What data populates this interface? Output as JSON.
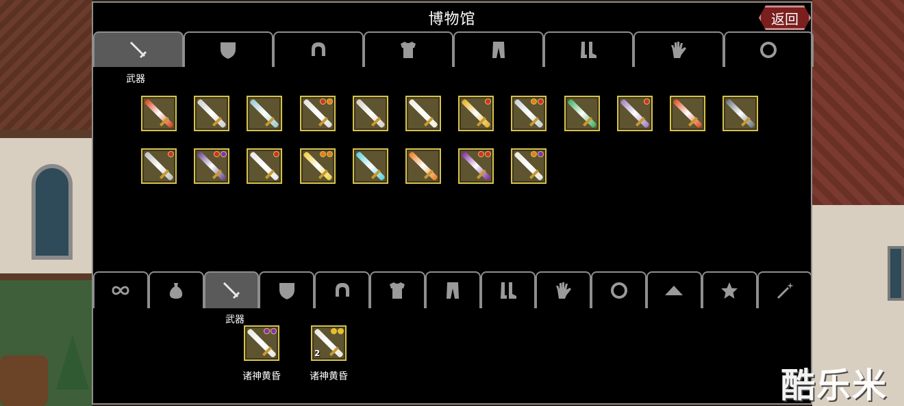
{
  "title": "博物馆",
  "return_label": "返回",
  "top_tabs": [
    {
      "icon": "sword-icon",
      "label": "武器",
      "active": true
    },
    {
      "icon": "shield-icon",
      "active": false
    },
    {
      "icon": "helmet-icon",
      "active": false
    },
    {
      "icon": "armor-icon",
      "active": false
    },
    {
      "icon": "pants-icon",
      "active": false
    },
    {
      "icon": "boots-icon",
      "active": false
    },
    {
      "icon": "glove-icon",
      "active": false
    },
    {
      "icon": "ring-icon",
      "active": false
    }
  ],
  "bottom_tabs": [
    {
      "icon": "infinity-icon",
      "active": false
    },
    {
      "icon": "bag-icon",
      "active": false
    },
    {
      "icon": "sword-icon",
      "label": "武器",
      "active": true
    },
    {
      "icon": "shield-icon",
      "active": false
    },
    {
      "icon": "helmet-icon",
      "active": false
    },
    {
      "icon": "armor-icon",
      "active": false
    },
    {
      "icon": "pants-icon",
      "active": false
    },
    {
      "icon": "boots-icon",
      "active": false
    },
    {
      "icon": "glove-icon",
      "active": false
    },
    {
      "icon": "ring-icon",
      "active": false
    },
    {
      "icon": "cloak-icon",
      "active": false
    },
    {
      "icon": "star-icon",
      "active": false
    },
    {
      "icon": "wand-icon",
      "active": false
    }
  ],
  "museum_items": [
    {
      "icon": "flame-blade-icon",
      "color": "#d8421e",
      "gems": []
    },
    {
      "icon": "sword-icon",
      "color": "#d0d0d0",
      "gems": []
    },
    {
      "icon": "sword-icon",
      "color": "#9cc8d0",
      "gems": []
    },
    {
      "icon": "sword-icon",
      "color": "#e0e0e0",
      "gems": [
        "#d03030",
        "#e08020"
      ]
    },
    {
      "icon": "sword-icon",
      "color": "#d8d0c8",
      "gems": []
    },
    {
      "icon": "sword-icon",
      "color": "#f0f0e0",
      "gems": []
    },
    {
      "icon": "trident-icon",
      "color": "#e8b020",
      "gems": [
        "#d03030"
      ]
    },
    {
      "icon": "sword-icon",
      "color": "#c8d0d8",
      "gems": [
        "#e08020",
        "#d03030"
      ]
    },
    {
      "icon": "sword-icon",
      "color": "#40b060",
      "gems": []
    },
    {
      "icon": "drill-icon",
      "color": "#a080c0",
      "gems": [
        "#d03030"
      ]
    },
    {
      "icon": "sword-icon",
      "color": "#e05020",
      "gems": []
    },
    {
      "icon": "sword-icon",
      "color": "#707880",
      "gems": []
    },
    {
      "icon": "sword-icon",
      "color": "#c0c0c0",
      "gems": [
        "#d03030"
      ]
    },
    {
      "icon": "sword-icon",
      "color": "#6a4a90",
      "gems": [
        "#d03030",
        "#8030c0"
      ]
    },
    {
      "icon": "sword-icon",
      "color": "#e8e8e8",
      "gems": [
        "#d03030"
      ]
    },
    {
      "icon": "sword-icon",
      "color": "#f0d040",
      "gems": [
        "#e08020",
        "#e08020"
      ]
    },
    {
      "icon": "sword-icon",
      "color": "#60d0e0",
      "gems": []
    },
    {
      "icon": "sword-icon",
      "color": "#f08020",
      "gems": []
    },
    {
      "icon": "sword-icon",
      "color": "#8030a0",
      "gems": [
        "#d03030",
        "#d03030"
      ]
    },
    {
      "icon": "sword-icon",
      "color": "#e8e8e0",
      "gems": [
        "#e08020",
        "#8030c0"
      ]
    }
  ],
  "inventory_items": [
    {
      "label": "诸神黄昏",
      "color": "#e8e8e0",
      "gems": [
        "#8030c0",
        "#8030c0"
      ],
      "count": ""
    },
    {
      "label": "诸神黄昏",
      "color": "#e8e8e0",
      "gems": [
        "#e8c020",
        "#e8c020"
      ],
      "count": "2"
    }
  ],
  "watermark": "酷乐米"
}
